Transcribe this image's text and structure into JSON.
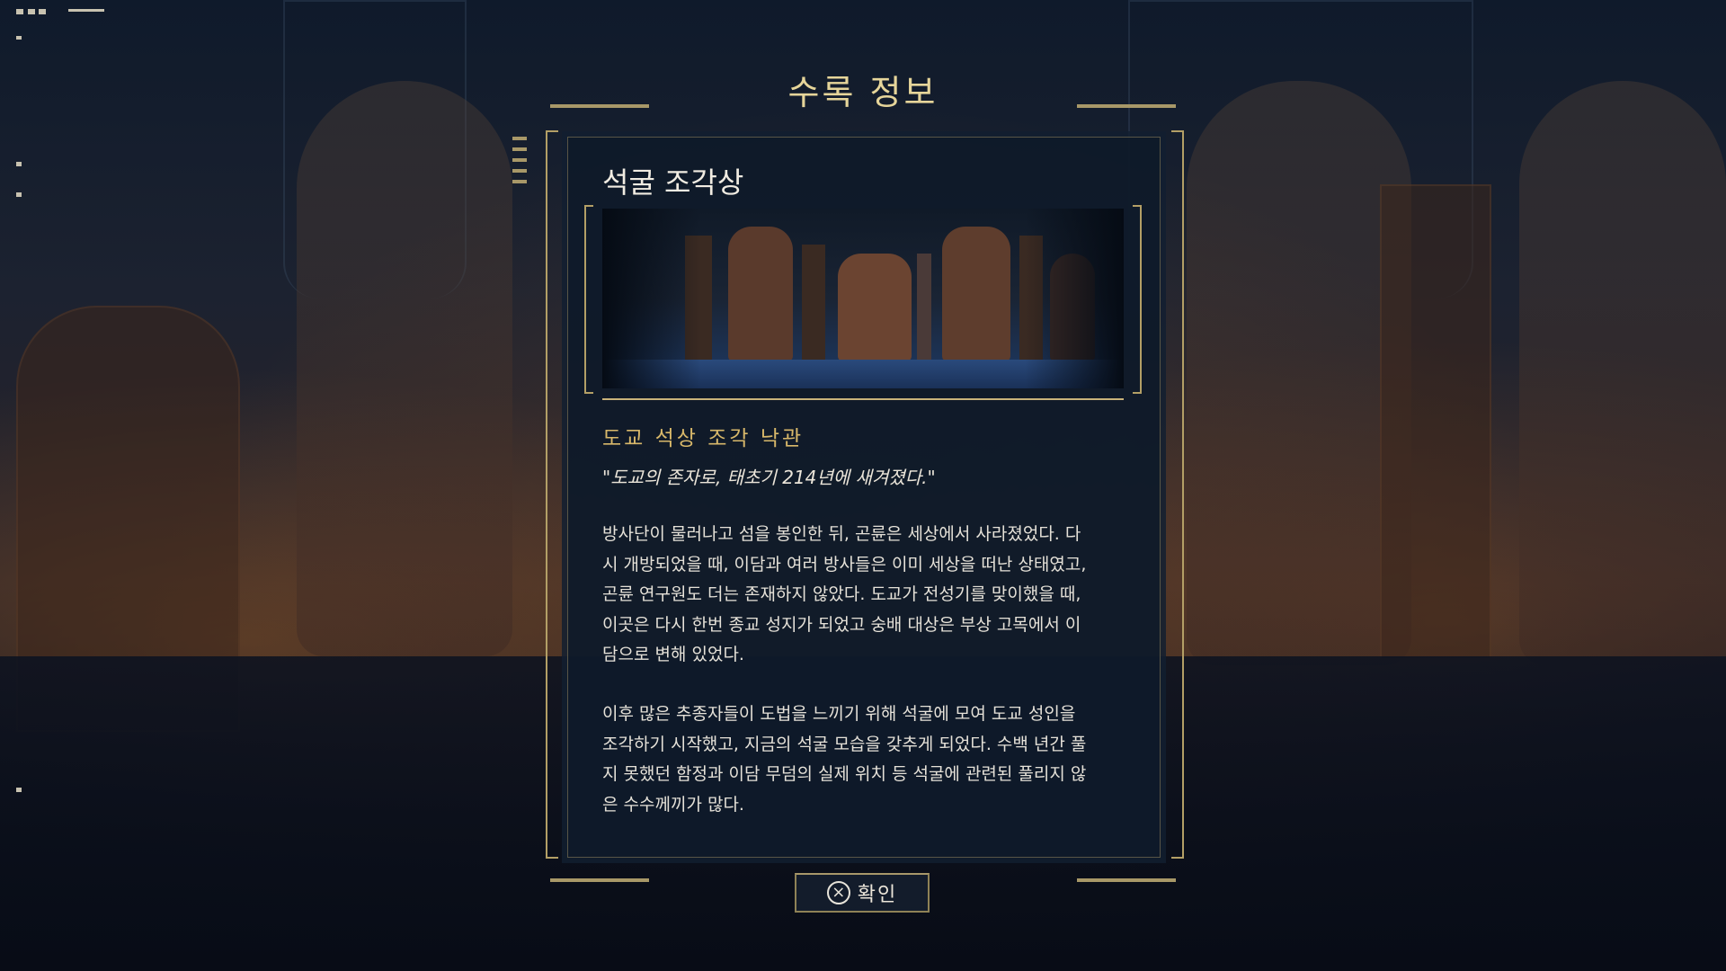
{
  "window": {
    "title": "수록 정보"
  },
  "entry": {
    "name": "석굴 조각상",
    "image_icon": "cave-statues-scene-image",
    "subtitle": "도교 석상 조각 낙관",
    "quote": "\"도교의 존자로, 태초기 214년에 새겨졌다.\"",
    "paragraphs": [
      "방사단이 물러나고 섬을 봉인한 뒤, 곤륜은 세상에서 사라졌었다. 다\n시 개방되었을 때, 이담과 여러 방사들은 이미 세상을 떠난 상태였고,\n곤륜 연구원도 더는 존재하지 않았다. 도교가 전성기를 맞이했을 때,\n이곳은 다시 한번 종교 성지가 되었고 숭배 대상은 부상 고목에서 이\n담으로 변해 있었다.",
      "이후 많은 추종자들이 도법을 느끼기 위해 석굴에 모여 도교 성인을\n조각하기 시작했고, 지금의 석굴 모습을 갖추게 되었다. 수백 년간 풀\n지 못했던 함정과 이담 무덤의 실제 위치 등 석굴에 관련된 풀리지 않\n은 수수께끼가 많다."
    ]
  },
  "confirm": {
    "icon": "cross-button-icon",
    "label": "확인"
  },
  "colors": {
    "title": "#e6d59a",
    "accent_gold": "#b39f66",
    "subtitle": "#d8b86a",
    "panel_bg": "#0f1a2a",
    "text": "#e5e1d8"
  }
}
